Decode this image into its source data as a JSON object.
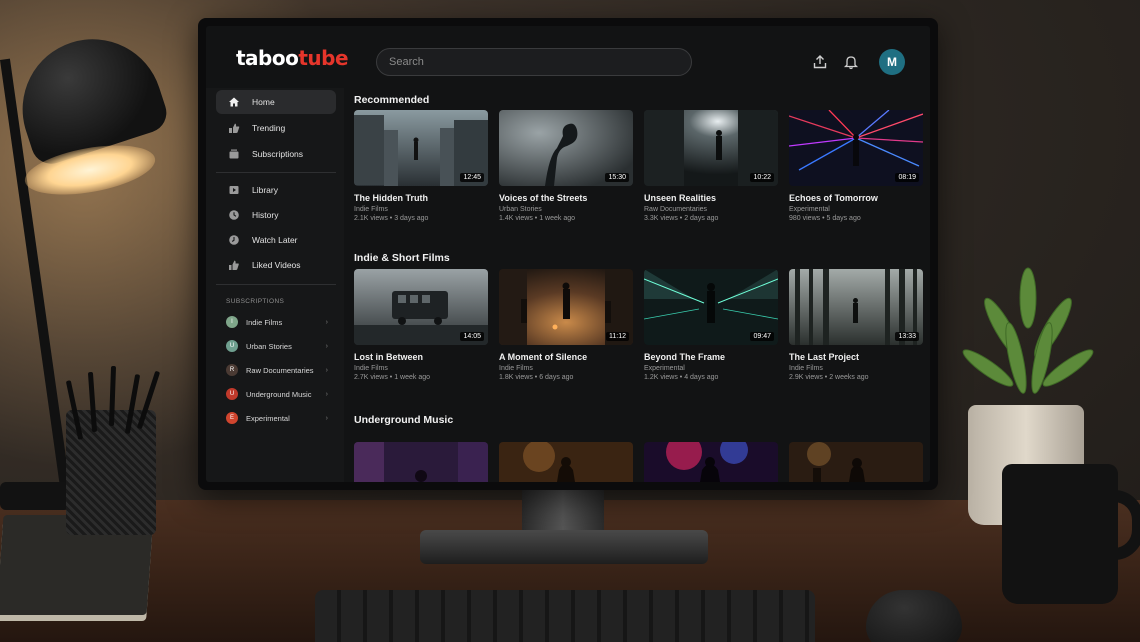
{
  "header": {
    "logo_part1": "taboo",
    "logo_part2": "tube",
    "search_placeholder": "Search",
    "avatar_letter": "M"
  },
  "sidebar": {
    "main": [
      {
        "label": "Home",
        "icon": "home-icon",
        "active": true
      },
      {
        "label": "Trending",
        "icon": "trending-icon"
      },
      {
        "label": "Subscriptions",
        "icon": "subscriptions-icon"
      }
    ],
    "library": [
      {
        "label": "Library",
        "icon": "library-icon"
      },
      {
        "label": "History",
        "icon": "history-icon"
      },
      {
        "label": "Watch Later",
        "icon": "watch-later-icon"
      },
      {
        "label": "Liked Videos",
        "icon": "liked-videos-icon"
      }
    ],
    "subscriptions_heading": "SUBSCRIPTIONS",
    "subscriptions": [
      {
        "label": "Indie Films",
        "initial": "I",
        "color": "#7fa68a"
      },
      {
        "label": "Urban Stories",
        "initial": "U",
        "color": "#6f9f8f"
      },
      {
        "label": "Raw Documentaries",
        "initial": "R",
        "color": "#4a3a33"
      },
      {
        "label": "Underground Music",
        "initial": "U",
        "color": "#c0392b"
      },
      {
        "label": "Experimental",
        "initial": "E",
        "color": "#d0452e"
      }
    ]
  },
  "sections": [
    {
      "title": "Recommended",
      "videos": [
        {
          "title": "The Hidden Truth",
          "channel": "Indie Films",
          "views": "2.1K views",
          "age": "3 days ago",
          "duration": "12:45"
        },
        {
          "title": "Voices of the Streets",
          "channel": "Urban Stories",
          "views": "1.4K views",
          "age": "1 week ago",
          "duration": "15:30"
        },
        {
          "title": "Unseen Realities",
          "channel": "Raw Documentaries",
          "views": "3.3K views",
          "age": "2 days ago",
          "duration": "10:22"
        },
        {
          "title": "Echoes of Tomorrow",
          "channel": "Experimental",
          "views": "980 views",
          "age": "5 days ago",
          "duration": "08:19"
        }
      ]
    },
    {
      "title": "Indie & Short Films",
      "videos": [
        {
          "title": "Lost in Between",
          "channel": "Indie Films",
          "views": "2.7K views",
          "age": "1 week ago",
          "duration": "14:05"
        },
        {
          "title": "A Moment of Silence",
          "channel": "Indie Films",
          "views": "1.8K views",
          "age": "6 days ago",
          "duration": "11:12"
        },
        {
          "title": "Beyond The Frame",
          "channel": "Experimental",
          "views": "1.2K views",
          "age": "4 days ago",
          "duration": "09:47"
        },
        {
          "title": "The Last Project",
          "channel": "Indie Films",
          "views": "2.9K views",
          "age": "2 weeks ago",
          "duration": "13:33"
        }
      ]
    },
    {
      "title": "Underground Music",
      "videos": []
    }
  ],
  "meta_separator": " • "
}
